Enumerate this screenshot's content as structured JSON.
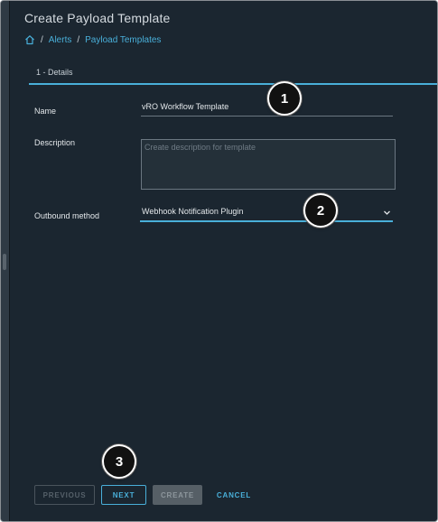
{
  "header": {
    "title": "Create Payload Template"
  },
  "breadcrumb": {
    "home_icon": "home-icon",
    "items": [
      "Alerts",
      "Payload Templates"
    ],
    "separator": "/"
  },
  "steps": [
    {
      "label": "1 - Details"
    }
  ],
  "form": {
    "name": {
      "label": "Name",
      "value": "vRO Workflow Template"
    },
    "description": {
      "label": "Description",
      "placeholder": "Create description for template",
      "value": ""
    },
    "outbound_method": {
      "label": "Outbound method",
      "value": "Webhook Notification Plugin",
      "icon": "chevron-down-icon"
    }
  },
  "callouts": [
    "1",
    "2",
    "3"
  ],
  "buttons": {
    "previous": "PREVIOUS",
    "next": "NEXT",
    "create": "CREATE",
    "cancel": "CANCEL"
  },
  "colors": {
    "background": "#1b2630",
    "accent": "#49afd9",
    "text": "#e4e8eb",
    "disabled": "#565f66"
  }
}
